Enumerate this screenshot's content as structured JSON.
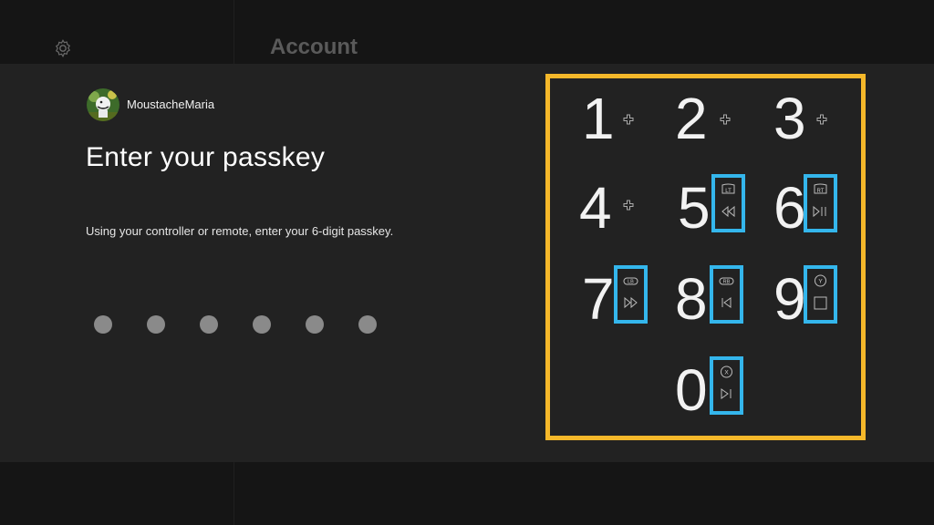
{
  "header": {
    "title": "Account",
    "settings_icon": "gear-icon"
  },
  "user": {
    "gamertag": "MoustacheMaria"
  },
  "prompt": {
    "heading": "Enter your passkey",
    "instructions": "Using your controller or remote, enter your 6-digit passkey."
  },
  "passkey": {
    "length": 6,
    "entered": 0
  },
  "keypad": {
    "keys": [
      {
        "digit": "1",
        "hint": "dpad-icon"
      },
      {
        "digit": "2",
        "hint": "dpad-icon"
      },
      {
        "digit": "3",
        "hint": "dpad-icon"
      },
      {
        "digit": "4",
        "hint": "dpad-icon"
      },
      {
        "digit": "5",
        "controller": "LT",
        "remote": "rewind-icon"
      },
      {
        "digit": "6",
        "controller": "RT",
        "remote": "play-pause-icon"
      },
      {
        "digit": "7",
        "controller": "LB",
        "remote": "fast-forward-icon"
      },
      {
        "digit": "8",
        "controller": "RB",
        "remote": "skip-back-icon"
      },
      {
        "digit": "9",
        "controller": "Y",
        "remote": "stop-icon"
      },
      {
        "digit": "0",
        "controller": "X",
        "remote": "skip-forward-icon"
      }
    ]
  },
  "colors": {
    "keypad_highlight": "#f5b82a",
    "button_highlight": "#34b6ec"
  }
}
